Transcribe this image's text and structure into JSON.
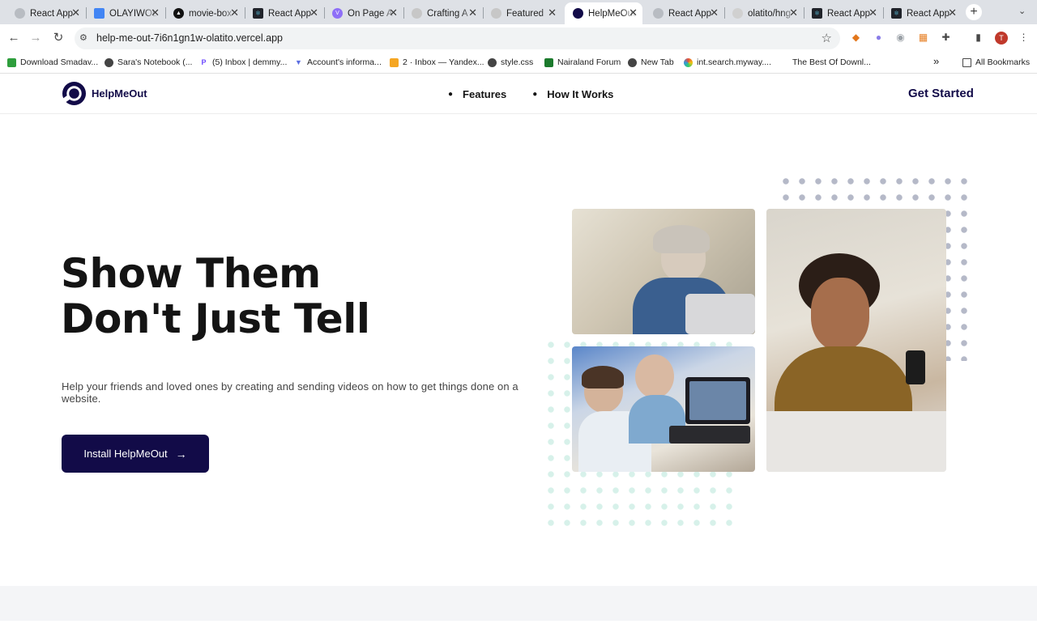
{
  "browser": {
    "tabs": [
      {
        "title": "React App",
        "favicon": "globe-icon",
        "active": false
      },
      {
        "title": "OLAYIWOLA",
        "favicon": "docs-icon",
        "active": false
      },
      {
        "title": "movie-box",
        "favicon": "vercel-icon",
        "active": false
      },
      {
        "title": "React App",
        "favicon": "react-icon",
        "active": false
      },
      {
        "title": "On Page A",
        "favicon": "vite-icon",
        "active": false
      },
      {
        "title": "Crafting A",
        "favicon": "flame-icon",
        "active": false
      },
      {
        "title": "Featured",
        "favicon": "flame-icon",
        "active": false
      },
      {
        "title": "HelpMeOut",
        "favicon": "helpmeout-icon",
        "active": true
      },
      {
        "title": "React App",
        "favicon": "globe-icon",
        "active": false
      },
      {
        "title": "olatito/hng",
        "favicon": "github-icon",
        "active": false
      },
      {
        "title": "React App",
        "favicon": "react-icon",
        "active": false
      },
      {
        "title": "React App",
        "favicon": "react-icon",
        "active": false
      }
    ],
    "url": "help-me-out-7i6n1gn1w-olatito.vercel.app",
    "profile_initial": "T",
    "bookmarks": [
      {
        "label": "Download Smadav...",
        "icon": "smadav-icon"
      },
      {
        "label": "Sara's Notebook (...",
        "icon": "globe-icon"
      },
      {
        "label": "(5) Inbox | demmy...",
        "icon": "proton-icon"
      },
      {
        "label": "Account's informa...",
        "icon": "triangle-icon"
      },
      {
        "label": "2 · Inbox — Yandex...",
        "icon": "mail-icon"
      },
      {
        "label": "style.css",
        "icon": "globe-icon"
      },
      {
        "label": "Nairaland Forum",
        "icon": "nairaland-icon"
      },
      {
        "label": "New Tab",
        "icon": "globe-icon"
      },
      {
        "label": "int.search.myway....",
        "icon": "myway-icon"
      },
      {
        "label": "The Best Of Downl...",
        "icon": ""
      }
    ],
    "all_bookmarks": "All Bookmarks"
  },
  "site": {
    "brand": "HelpMeOut",
    "nav": [
      "Features",
      "How It Works"
    ],
    "cta": "Get Started",
    "hero": {
      "headline_line1": "Show Them",
      "headline_line2": "Don't Just Tell",
      "subtext": "Help your friends and loved ones by creating and sending videos on how to get things done on a website.",
      "button": "Install HelpMeOut",
      "button_arrow": "→"
    },
    "colors": {
      "primary": "#120b48",
      "text": "#141414",
      "dots_gray": "#b5b9c8",
      "dots_mint": "#d7f1ea"
    }
  }
}
